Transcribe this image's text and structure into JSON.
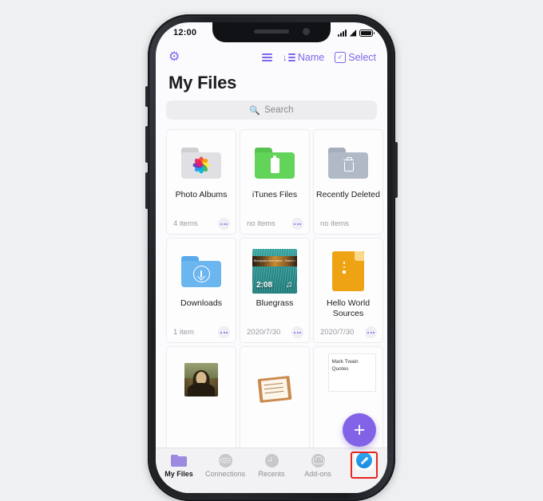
{
  "device": {
    "status_bar": {
      "time": "12:00",
      "signal_icon": "cellular-bars-icon",
      "wifi_icon": "wifi-icon",
      "battery_icon": "battery-full-icon"
    }
  },
  "top_nav": {
    "settings_icon": "gear-icon",
    "view_toggle_label": "",
    "view_toggle_icon": "list-view-icon",
    "sort_label": "Name",
    "sort_icon": "sort-descending-icon",
    "select_label": "Select",
    "select_icon": "checkbox-checked-icon"
  },
  "header": {
    "title": "My Files"
  },
  "search": {
    "placeholder": "Search",
    "icon": "search-icon"
  },
  "grid": {
    "items": [
      {
        "name": "Photo Albums",
        "meta": "4 items",
        "icon": "photos-folder-icon",
        "has_more": true
      },
      {
        "name": "iTunes Files",
        "meta": "no items",
        "icon": "itunes-folder-icon",
        "has_more": true
      },
      {
        "name": "Recently Deleted",
        "meta": "no items",
        "icon": "trash-folder-icon",
        "has_more": false
      },
      {
        "name": "Downloads",
        "meta": "1 item",
        "icon": "downloads-folder-icon",
        "has_more": true
      },
      {
        "name": "Bluegrass",
        "meta": "2020/7/30",
        "icon": "album-art-thumb",
        "duration": "2:08",
        "banner_text": "Bluegrass free music - fesmix.com",
        "has_more": true
      },
      {
        "name": "Hello World Sources",
        "meta": "2020/7/30",
        "icon": "code-document-icon",
        "has_more": true
      },
      {
        "name": "",
        "meta": "",
        "icon": "mona-lisa-thumb",
        "has_more": false
      },
      {
        "name": "",
        "meta": "",
        "icon": "clipboard-note-thumb",
        "has_more": false
      },
      {
        "name": "Mark Twain Quotes",
        "meta": "",
        "icon": "text-document-thumb",
        "has_more": false
      }
    ]
  },
  "fab": {
    "label": "+",
    "color": "#8263e8"
  },
  "tab_bar": {
    "tabs": [
      {
        "label": "My Files",
        "icon": "folder-icon",
        "active": true
      },
      {
        "label": "Connections",
        "icon": "wifi-icon",
        "active": false
      },
      {
        "label": "Recents",
        "icon": "clock-icon",
        "active": false
      },
      {
        "label": "Add-ons",
        "icon": "cart-icon",
        "active": false
      },
      {
        "label": "",
        "icon": "safari-compass-icon",
        "active": false,
        "highlighted": true
      }
    ]
  },
  "annotation": {
    "highlight_color": "#e8241f",
    "target": "safari-compass-icon"
  },
  "theme": {
    "accent": "#7b68ee",
    "background": "#eff0f2",
    "screen_bg": "#fbfbfd"
  }
}
